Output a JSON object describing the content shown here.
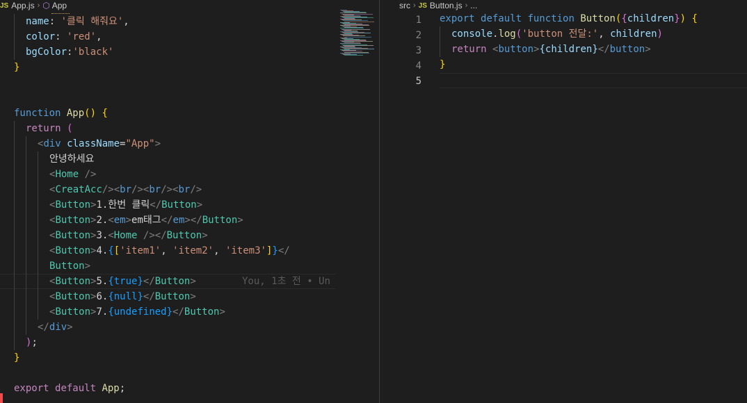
{
  "left_editor": {
    "breadcrumb": {
      "file": "App.js",
      "symbol": "App",
      "file_icon": "JS"
    },
    "blame": "You, 1초 전 • Un",
    "lines": [
      {
        "indent": 1,
        "tokens": [
          {
            "t": "name",
            "c": "t-var"
          },
          {
            "t": ": ",
            "c": "t-txt"
          },
          {
            "t": "'클릭 해줘요'",
            "c": "t-str"
          },
          {
            "t": ",",
            "c": "t-txt"
          }
        ]
      },
      {
        "indent": 1,
        "tokens": [
          {
            "t": "color",
            "c": "t-var"
          },
          {
            "t": ": ",
            "c": "t-txt"
          },
          {
            "t": "'red'",
            "c": "t-str"
          },
          {
            "t": ",",
            "c": "t-txt"
          }
        ]
      },
      {
        "indent": 1,
        "tokens": [
          {
            "t": "bgColor",
            "c": "t-var"
          },
          {
            "t": ":",
            "c": "t-txt"
          },
          {
            "t": "'black'",
            "c": "t-str"
          }
        ]
      },
      {
        "indent": 0,
        "tokens": [
          {
            "t": "}",
            "c": "t-b1"
          }
        ]
      },
      {
        "indent": 0,
        "tokens": []
      },
      {
        "indent": 0,
        "tokens": []
      },
      {
        "indent": 0,
        "tokens": [
          {
            "t": "function ",
            "c": "t-kw"
          },
          {
            "t": "App",
            "c": "t-fn"
          },
          {
            "t": "() {",
            "c": "t-b1"
          }
        ]
      },
      {
        "indent": 1,
        "tokens": [
          {
            "t": "return ",
            "c": "t-ctl"
          },
          {
            "t": "(",
            "c": "t-b2"
          }
        ]
      },
      {
        "indent": 2,
        "tokens": [
          {
            "t": "<",
            "c": "t-tb"
          },
          {
            "t": "div ",
            "c": "t-tag"
          },
          {
            "t": "className",
            "c": "t-attr"
          },
          {
            "t": "=",
            "c": "t-txt"
          },
          {
            "t": "\"App\"",
            "c": "t-str"
          },
          {
            "t": ">",
            "c": "t-tb"
          }
        ]
      },
      {
        "indent": 3,
        "tokens": [
          {
            "t": "안녕하세요",
            "c": "t-txt"
          }
        ]
      },
      {
        "indent": 3,
        "tokens": [
          {
            "t": "<",
            "c": "t-tb"
          },
          {
            "t": "Home ",
            "c": "t-comp"
          },
          {
            "t": "/>",
            "c": "t-tb"
          }
        ]
      },
      {
        "indent": 3,
        "tokens": [
          {
            "t": "<",
            "c": "t-tb"
          },
          {
            "t": "CreatAcc",
            "c": "t-comp"
          },
          {
            "t": "/><",
            "c": "t-tb"
          },
          {
            "t": "br",
            "c": "t-tag"
          },
          {
            "t": "/><",
            "c": "t-tb"
          },
          {
            "t": "br",
            "c": "t-tag"
          },
          {
            "t": "/><",
            "c": "t-tb"
          },
          {
            "t": "br",
            "c": "t-tag"
          },
          {
            "t": "/>",
            "c": "t-tb"
          }
        ]
      },
      {
        "indent": 3,
        "tokens": [
          {
            "t": "<",
            "c": "t-tb"
          },
          {
            "t": "Button",
            "c": "t-comp"
          },
          {
            "t": ">",
            "c": "t-tb"
          },
          {
            "t": "1.한번 클릭",
            "c": "t-txt"
          },
          {
            "t": "</",
            "c": "t-tb"
          },
          {
            "t": "Button",
            "c": "t-comp"
          },
          {
            "t": ">",
            "c": "t-tb"
          }
        ]
      },
      {
        "indent": 3,
        "tokens": [
          {
            "t": "<",
            "c": "t-tb"
          },
          {
            "t": "Button",
            "c": "t-comp"
          },
          {
            "t": ">",
            "c": "t-tb"
          },
          {
            "t": "2.",
            "c": "t-txt"
          },
          {
            "t": "<",
            "c": "t-tb"
          },
          {
            "t": "em",
            "c": "t-tag"
          },
          {
            "t": ">",
            "c": "t-tb"
          },
          {
            "t": "em태그",
            "c": "t-txt"
          },
          {
            "t": "</",
            "c": "t-tb"
          },
          {
            "t": "em",
            "c": "t-tag"
          },
          {
            "t": "></",
            "c": "t-tb"
          },
          {
            "t": "Button",
            "c": "t-comp"
          },
          {
            "t": ">",
            "c": "t-tb"
          }
        ]
      },
      {
        "indent": 3,
        "tokens": [
          {
            "t": "<",
            "c": "t-tb"
          },
          {
            "t": "Button",
            "c": "t-comp"
          },
          {
            "t": ">",
            "c": "t-tb"
          },
          {
            "t": "3.",
            "c": "t-txt"
          },
          {
            "t": "<",
            "c": "t-tb"
          },
          {
            "t": "Home ",
            "c": "t-comp"
          },
          {
            "t": "/></",
            "c": "t-tb"
          },
          {
            "t": "Button",
            "c": "t-comp"
          },
          {
            "t": ">",
            "c": "t-tb"
          }
        ]
      },
      {
        "indent": 3,
        "tokens": [
          {
            "t": "<",
            "c": "t-tb"
          },
          {
            "t": "Button",
            "c": "t-comp"
          },
          {
            "t": ">",
            "c": "t-tb"
          },
          {
            "t": "4.",
            "c": "t-txt"
          },
          {
            "t": "{",
            "c": "t-b3"
          },
          {
            "t": "[",
            "c": "t-b1"
          },
          {
            "t": "'item1'",
            "c": "t-str"
          },
          {
            "t": ", ",
            "c": "t-txt"
          },
          {
            "t": "'item2'",
            "c": "t-str"
          },
          {
            "t": ", ",
            "c": "t-txt"
          },
          {
            "t": "'item3'",
            "c": "t-str"
          },
          {
            "t": "]",
            "c": "t-b1"
          },
          {
            "t": "}",
            "c": "t-b3"
          },
          {
            "t": "</",
            "c": "t-tb"
          }
        ]
      },
      {
        "indent": 3,
        "tokens": [
          {
            "t": "Button",
            "c": "t-comp"
          },
          {
            "t": ">",
            "c": "t-tb"
          }
        ]
      },
      {
        "indent": 3,
        "tokens": [
          {
            "t": "<",
            "c": "t-tb"
          },
          {
            "t": "Button",
            "c": "t-comp"
          },
          {
            "t": ">",
            "c": "t-tb"
          },
          {
            "t": "5.",
            "c": "t-txt"
          },
          {
            "t": "{true}",
            "c": "t-b3"
          },
          {
            "t": "</",
            "c": "t-tb"
          },
          {
            "t": "Button",
            "c": "t-comp"
          },
          {
            "t": ">",
            "c": "t-tb"
          }
        ]
      },
      {
        "indent": 3,
        "tokens": [
          {
            "t": "<",
            "c": "t-tb"
          },
          {
            "t": "Button",
            "c": "t-comp"
          },
          {
            "t": ">",
            "c": "t-tb"
          },
          {
            "t": "6.",
            "c": "t-txt"
          },
          {
            "t": "{null}",
            "c": "t-b3"
          },
          {
            "t": "</",
            "c": "t-tb"
          },
          {
            "t": "Button",
            "c": "t-comp"
          },
          {
            "t": ">",
            "c": "t-tb"
          }
        ]
      },
      {
        "indent": 3,
        "tokens": [
          {
            "t": "<",
            "c": "t-tb"
          },
          {
            "t": "Button",
            "c": "t-comp"
          },
          {
            "t": ">",
            "c": "t-tb"
          },
          {
            "t": "7.",
            "c": "t-txt"
          },
          {
            "t": "{undefined}",
            "c": "t-b3"
          },
          {
            "t": "</",
            "c": "t-tb"
          },
          {
            "t": "Button",
            "c": "t-comp"
          },
          {
            "t": ">",
            "c": "t-tb"
          }
        ]
      },
      {
        "indent": 2,
        "tokens": [
          {
            "t": "</",
            "c": "t-tb"
          },
          {
            "t": "div",
            "c": "t-tag"
          },
          {
            "t": ">",
            "c": "t-tb"
          }
        ]
      },
      {
        "indent": 1,
        "tokens": [
          {
            "t": ")",
            "c": "t-b2"
          },
          {
            "t": ";",
            "c": "t-txt"
          }
        ]
      },
      {
        "indent": 0,
        "tokens": [
          {
            "t": "}",
            "c": "t-b1"
          }
        ]
      },
      {
        "indent": 0,
        "tokens": []
      },
      {
        "indent": 0,
        "tokens": [
          {
            "t": "export ",
            "c": "t-ctl"
          },
          {
            "t": "default ",
            "c": "t-ctl"
          },
          {
            "t": "App",
            "c": "t-fn"
          },
          {
            "t": ";",
            "c": "t-txt"
          }
        ]
      }
    ]
  },
  "right_editor": {
    "breadcrumb": {
      "folder": "src",
      "file": "Button.js",
      "more": "...",
      "file_icon": "JS"
    },
    "line_numbers": [
      "1",
      "2",
      "3",
      "4",
      "5"
    ],
    "active_line": 5,
    "lines": [
      {
        "indent": 0,
        "tokens": [
          {
            "t": "export ",
            "c": "t-kw"
          },
          {
            "t": "default ",
            "c": "t-kw"
          },
          {
            "t": "function ",
            "c": "t-kw"
          },
          {
            "t": "Button",
            "c": "t-fn"
          },
          {
            "t": "(",
            "c": "t-b1"
          },
          {
            "t": "{",
            "c": "t-b2"
          },
          {
            "t": "children",
            "c": "t-var"
          },
          {
            "t": "}",
            "c": "t-b2"
          },
          {
            "t": ") {",
            "c": "t-b1"
          }
        ]
      },
      {
        "indent": 1,
        "tokens": [
          {
            "t": "console",
            "c": "t-var"
          },
          {
            "t": ".",
            "c": "t-txt"
          },
          {
            "t": "log",
            "c": "t-fn"
          },
          {
            "t": "(",
            "c": "t-b2"
          },
          {
            "t": "'button 전달:'",
            "c": "t-str"
          },
          {
            "t": ", ",
            "c": "t-txt"
          },
          {
            "t": "children",
            "c": "t-var"
          },
          {
            "t": ")",
            "c": "t-b2"
          }
        ]
      },
      {
        "indent": 1,
        "tokens": [
          {
            "t": "return ",
            "c": "t-ctl"
          },
          {
            "t": "<",
            "c": "t-tb"
          },
          {
            "t": "button",
            "c": "t-tag"
          },
          {
            "t": ">",
            "c": "t-tb"
          },
          {
            "t": "{children}",
            "c": "t-var"
          },
          {
            "t": "</",
            "c": "t-tb"
          },
          {
            "t": "button",
            "c": "t-tag"
          },
          {
            "t": ">",
            "c": "t-tb"
          }
        ]
      },
      {
        "indent": 0,
        "tokens": [
          {
            "t": "}",
            "c": "t-b1"
          }
        ]
      },
      {
        "indent": 0,
        "tokens": []
      }
    ]
  }
}
